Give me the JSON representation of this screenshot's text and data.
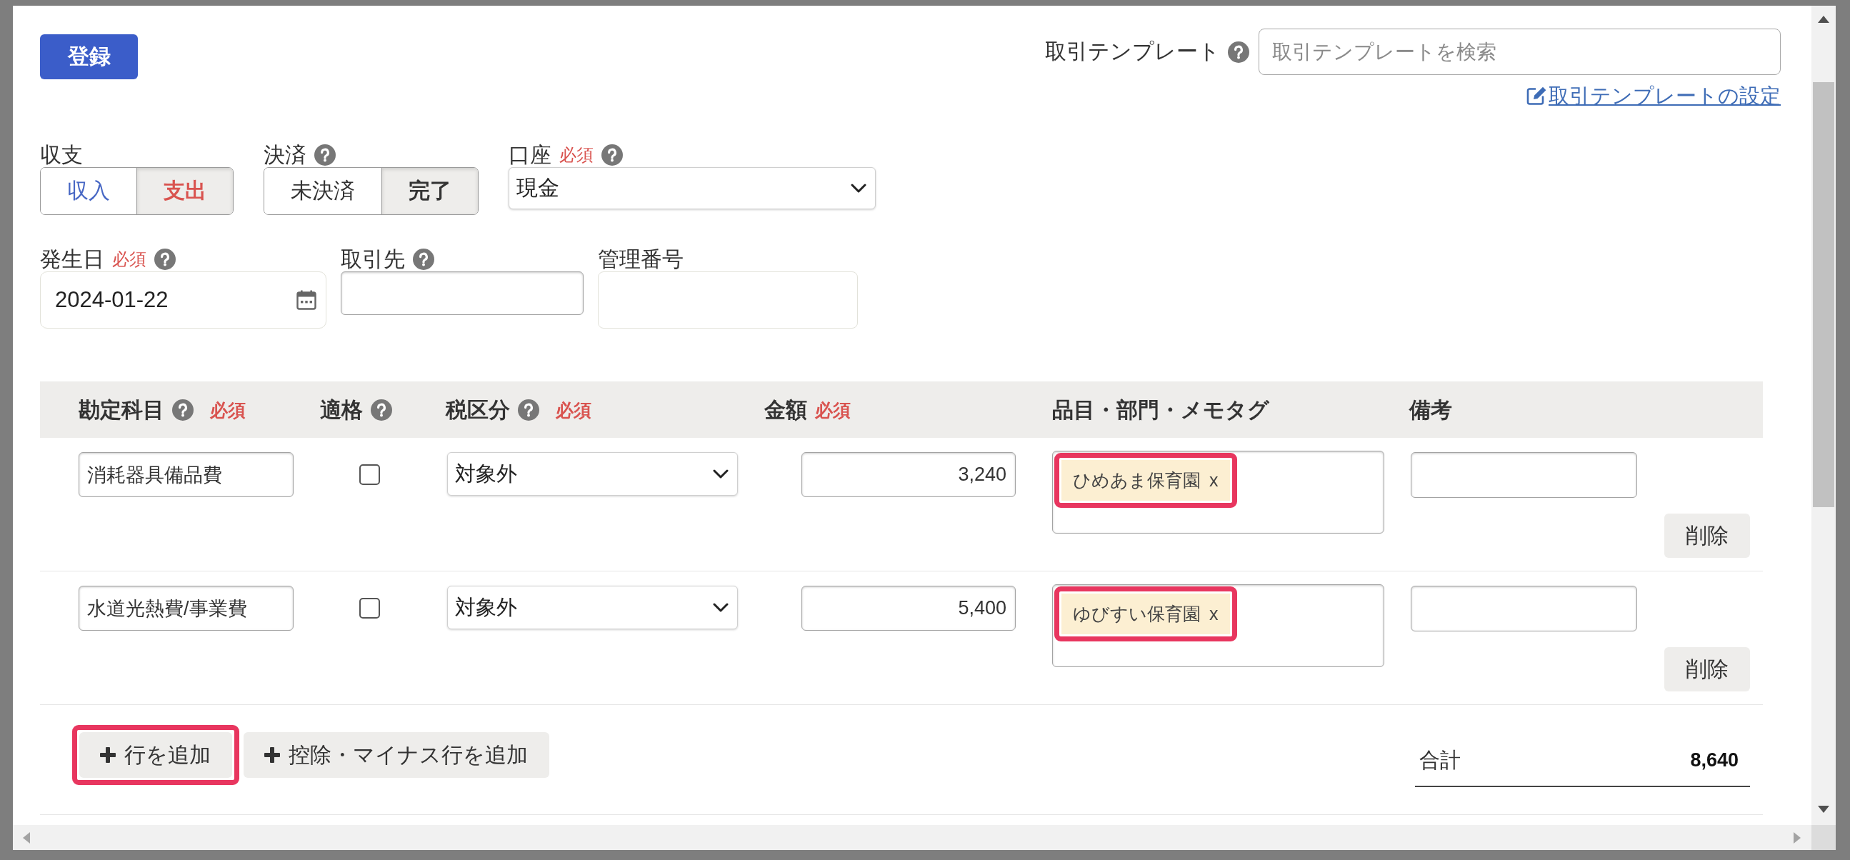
{
  "header": {
    "register_button": "登録",
    "template": {
      "label": "取引テンプレート",
      "help": true,
      "placeholder": "取引テンプレートを検索",
      "settings_link": "取引テンプレートの設定"
    }
  },
  "form": {
    "field_rows": [
      [
        {
          "kind": "segmented",
          "label": "収支",
          "options": [
            {
              "label": "収入",
              "selected": false,
              "color": "#4767c4"
            },
            {
              "label": "支出",
              "selected": true,
              "color": "#d9534f"
            }
          ]
        },
        {
          "kind": "segmented",
          "label": "決済",
          "help": true,
          "options": [
            {
              "label": "未決済",
              "selected": false
            },
            {
              "label": "完了",
              "selected": true
            }
          ]
        },
        {
          "kind": "select",
          "label": "口座",
          "required_text": "必須",
          "help": true,
          "value": "現金"
        }
      ],
      [
        {
          "kind": "date",
          "label": "発生日",
          "required_text": "必須",
          "help": true,
          "value": "2024-01-22"
        },
        {
          "kind": "search",
          "label": "取引先",
          "help": true
        },
        {
          "kind": "text",
          "label": "管理番号"
        }
      ]
    ]
  },
  "table": {
    "columns": [
      {
        "label": "勘定科目",
        "help": true,
        "required_text": "必須"
      },
      {
        "label": "適格",
        "help": true
      },
      {
        "label": "税区分",
        "help": true,
        "required_text": "必須"
      },
      {
        "label": "金額",
        "required_text": "必須"
      },
      {
        "label": "品目・部門・メモタグ"
      },
      {
        "label": "備考"
      }
    ],
    "rows": [
      {
        "account": "消耗器具備品費",
        "qualified": false,
        "tax_category": "対象外",
        "amount": "3,240",
        "tags": [
          {
            "label": "ひめあま保育園",
            "remove": "x",
            "highlighted": true
          }
        ],
        "delete_button": "削除"
      },
      {
        "account": "水道光熱費/事業費",
        "qualified": false,
        "tax_category": "対象外",
        "amount": "5,400",
        "tags": [
          {
            "label": "ゆびすい保育園",
            "remove": "x",
            "highlighted": true
          }
        ],
        "delete_button": "削除"
      }
    ]
  },
  "footer": {
    "add_buttons": [
      {
        "label": "行を追加",
        "highlighted": true
      },
      {
        "label": "控除・マイナス行を追加",
        "highlighted": false
      }
    ],
    "total": {
      "label": "合計",
      "value": "8,640"
    }
  }
}
